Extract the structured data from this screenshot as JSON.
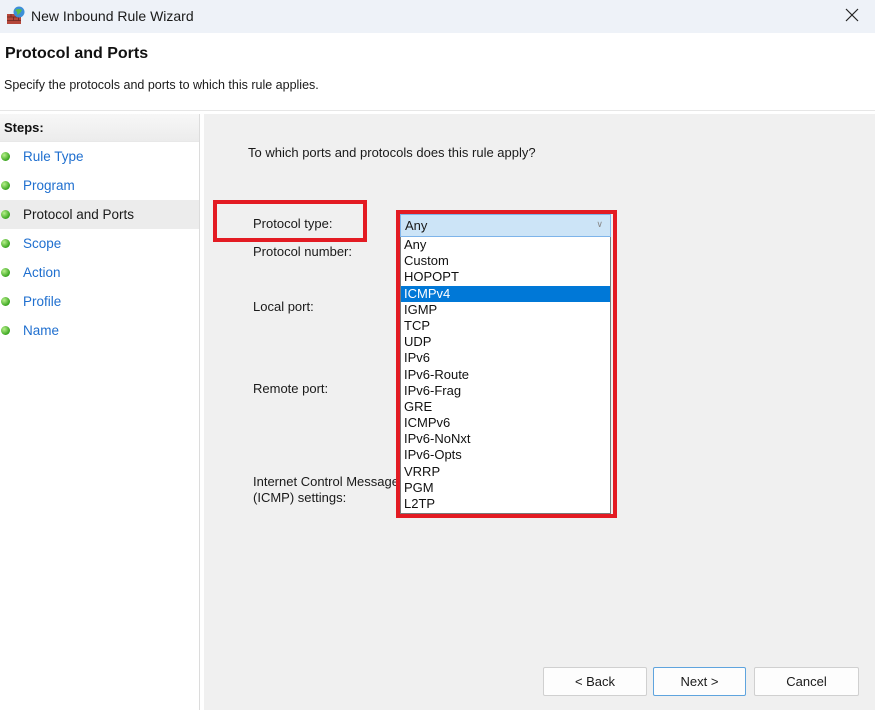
{
  "window": {
    "title": "New Inbound Rule Wizard",
    "app_icon": "firewall-globe-icon",
    "close_icon": "close-icon"
  },
  "header": {
    "title": "Protocol and Ports",
    "subtitle": "Specify the protocols and ports to which this rule applies."
  },
  "steps": {
    "heading": "Steps:",
    "items": [
      {
        "label": "Rule Type",
        "active": false
      },
      {
        "label": "Program",
        "active": false
      },
      {
        "label": "Protocol and Ports",
        "active": true
      },
      {
        "label": "Scope",
        "active": false
      },
      {
        "label": "Action",
        "active": false
      },
      {
        "label": "Profile",
        "active": false
      },
      {
        "label": "Name",
        "active": false
      }
    ]
  },
  "main": {
    "question": "To which ports and protocols does this rule apply?",
    "labels": {
      "protocol_type": "Protocol type:",
      "protocol_number": "Protocol number:",
      "local_port": "Local port:",
      "remote_port": "Remote port:",
      "icmp_line1": "Internet Control Message Protocol",
      "icmp_line2": "(ICMP) settings:"
    },
    "protocol_combo": {
      "value": "Any",
      "options": [
        "Any",
        "Custom",
        "HOPOPT",
        "ICMPv4",
        "IGMP",
        "TCP",
        "UDP",
        "IPv6",
        "IPv6-Route",
        "IPv6-Frag",
        "GRE",
        "ICMPv6",
        "IPv6-NoNxt",
        "IPv6-Opts",
        "VRRP",
        "PGM",
        "L2TP"
      ],
      "highlighted": "ICMPv4"
    }
  },
  "buttons": {
    "back": "< Back",
    "next": "Next >",
    "cancel": "Cancel"
  },
  "colors": {
    "annotation": "#e31b23",
    "selection": "#0078d7",
    "link": "#1f6fcf"
  }
}
